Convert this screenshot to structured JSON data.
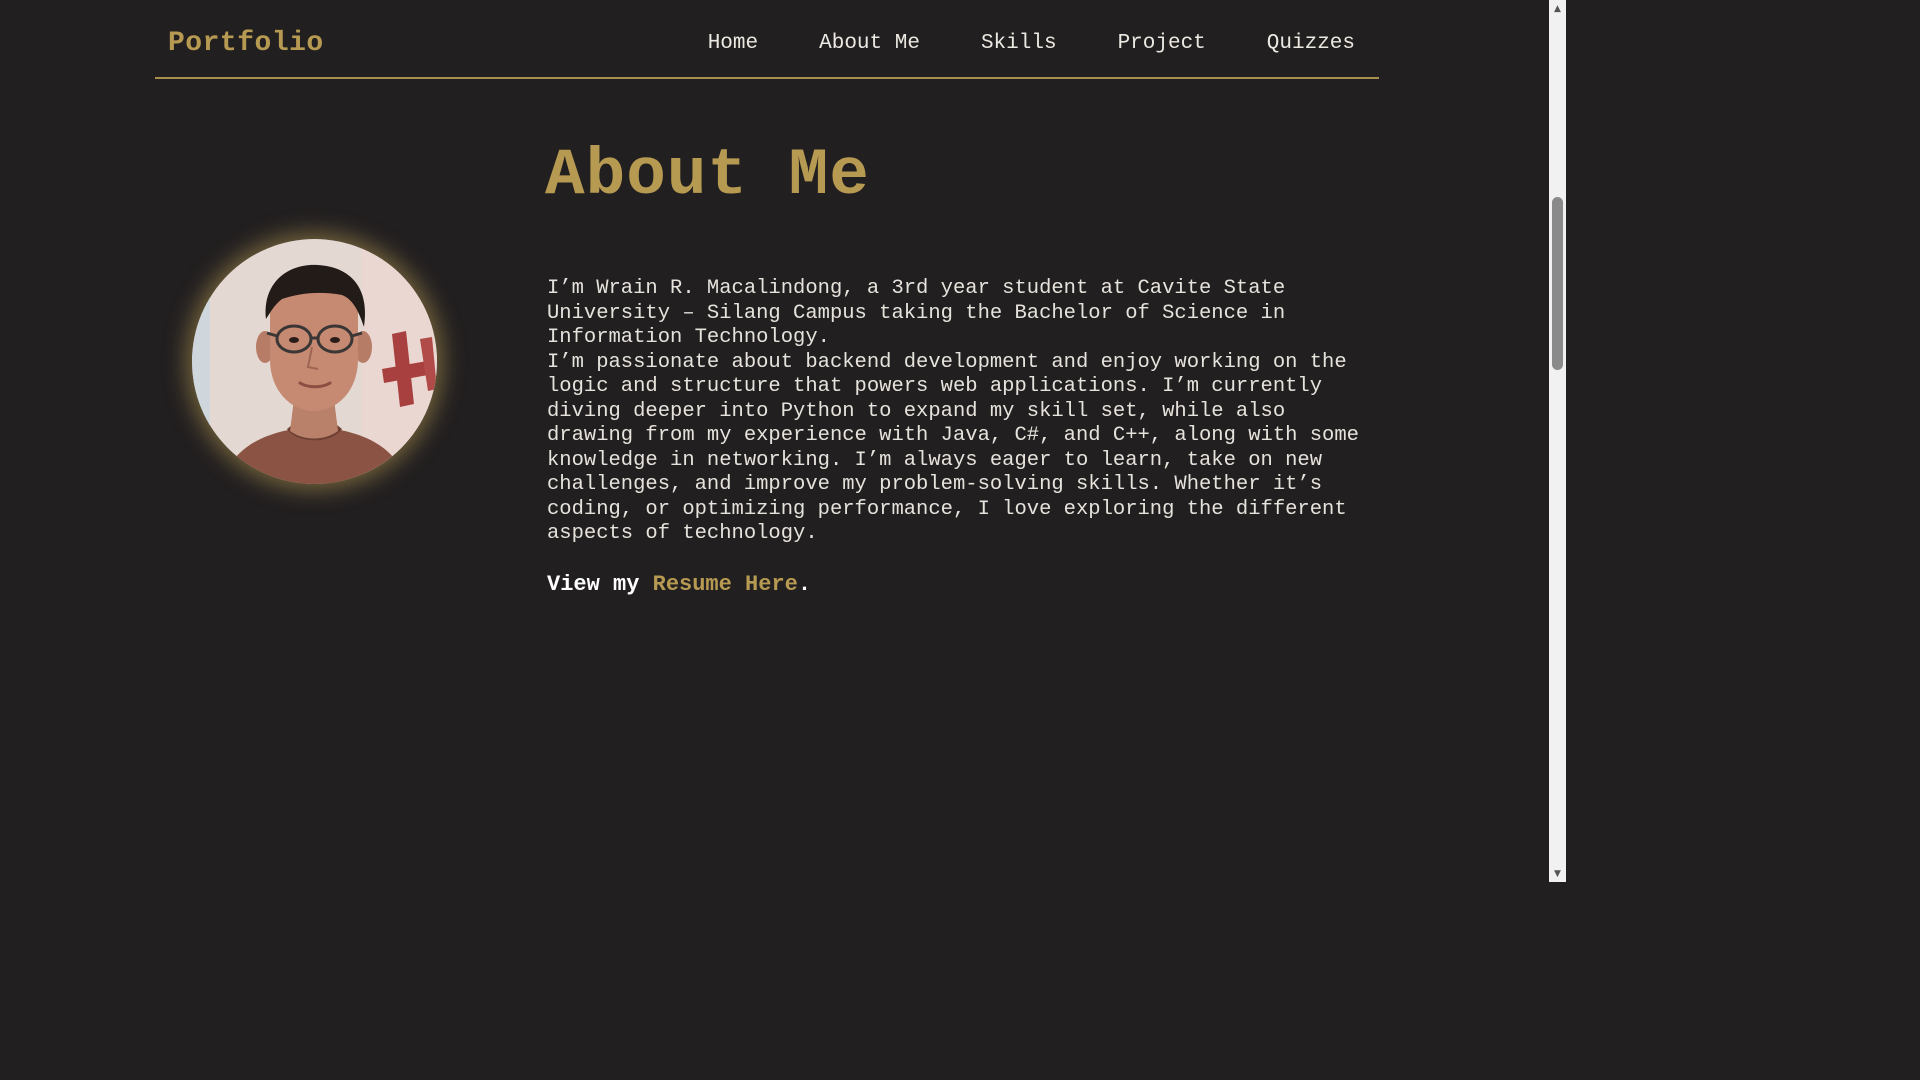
{
  "header": {
    "brand": "Portfolio",
    "nav": [
      {
        "label": "Home"
      },
      {
        "label": "About Me"
      },
      {
        "label": "Skills"
      },
      {
        "label": "Project"
      },
      {
        "label": "Quizzes"
      }
    ]
  },
  "about": {
    "title": "About Me",
    "paragraph1": "I’m Wrain R. Macalindong, a 3rd year student at Cavite State University – Silang Campus taking the Bachelor of Science in Information Technology.",
    "paragraph2": "I’m passionate about backend development and enjoy working on the logic and structure that powers web applications. I’m currently diving deeper into Python to expand my skill set, while also drawing from my experience with Java, C#, and C++, along with some knowledge in networking. I’m always eager to learn, take on new challenges, and improve my problem-solving skills. Whether it’s coding, or optimizing performance, I love exploring the different aspects of technology.",
    "resume_prefix": "View my ",
    "resume_link": "Resume Here",
    "resume_suffix": "."
  },
  "colors": {
    "background": "#221f20",
    "accent": "#b79a52",
    "text": "#e6e2dc"
  },
  "icons": {
    "avatar": "profile-photo",
    "scroll_up": "scroll-up-arrow-icon",
    "scroll_down": "scroll-down-arrow-icon"
  }
}
